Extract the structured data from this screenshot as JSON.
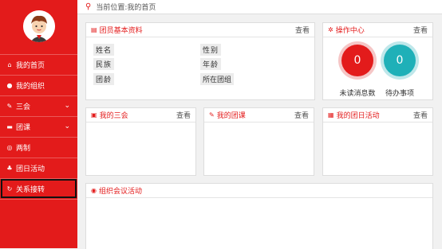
{
  "breadcrumb": "当前位置:我的首页",
  "sidebar": {
    "items": [
      {
        "label": "我的首页",
        "icon": "home-icon"
      },
      {
        "label": "我的组织",
        "icon": "group-icon"
      },
      {
        "label": "三会",
        "icon": "edit-icon"
      },
      {
        "label": "团课",
        "icon": "folder-icon"
      },
      {
        "label": "两制",
        "icon": "target-icon"
      },
      {
        "label": "团日活动",
        "icon": "leaf-icon"
      },
      {
        "label": "关系接转",
        "icon": "refresh-icon"
      }
    ]
  },
  "panels": {
    "basic": {
      "title": "团员基本资料",
      "more": "查看",
      "labels": [
        "姓名",
        "民族",
        "团龄",
        "性别",
        "年龄",
        "所在团组"
      ]
    },
    "ops": {
      "title": "操作中心",
      "more": "查看",
      "unread_count": "0",
      "unread_label": "未读消息数",
      "todo_count": "0",
      "todo_label": "待办事项"
    },
    "sanhui": {
      "title": "我的三会",
      "more": "查看"
    },
    "tuanke": {
      "title": "我的团课",
      "more": "查看"
    },
    "tuanri": {
      "title": "我的团日活动",
      "more": "查看"
    },
    "org": {
      "title": "组织会议活动"
    }
  },
  "colors": {
    "accent": "#e31b1b",
    "teal": "#1fb0b8"
  }
}
